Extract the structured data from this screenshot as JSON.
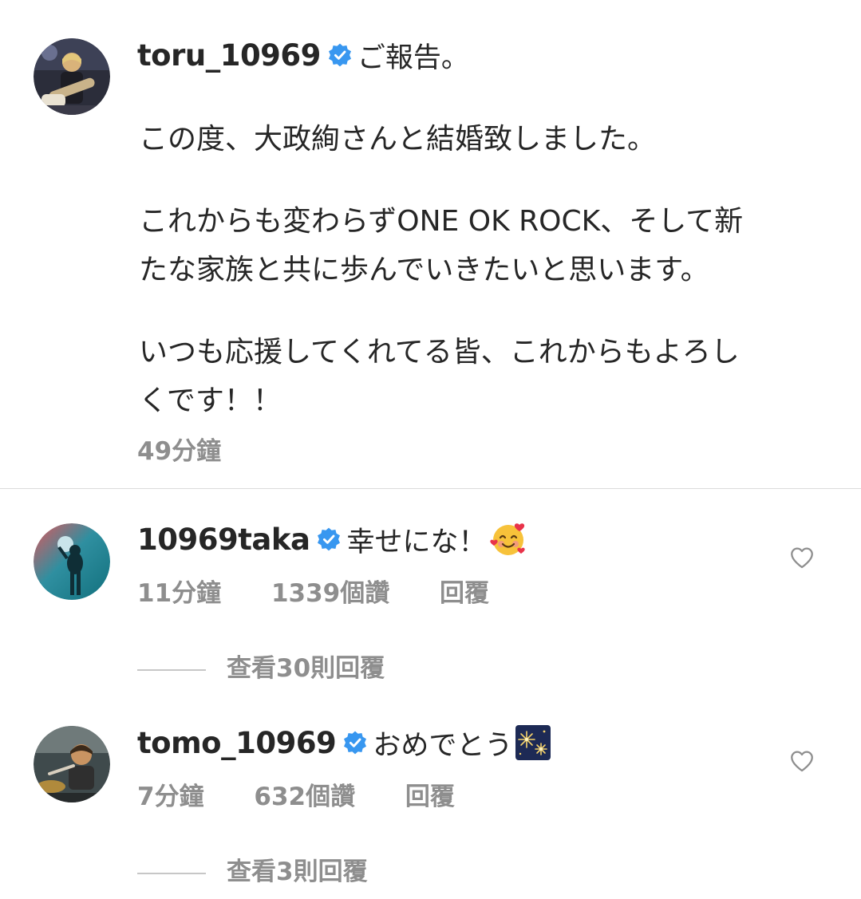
{
  "post": {
    "username": "toru_10969",
    "caption_title": "ご報告。",
    "caption_lines": [
      "この度、大政絢さんと結婚致しました。",
      "これからも変わらずONE OK ROCK、そして新",
      "たな家族と共に歩んでいきたいと思います。",
      "いつも応援してくれてる皆、これからもよろし",
      "くです！！"
    ],
    "time": "49分鐘",
    "avatar_icon": "guitarist-avatar"
  },
  "comments": [
    {
      "username": "10969taka",
      "text": "幸せにな！",
      "emoji": "smiling-face-with-hearts-emoji",
      "time": "11分鐘",
      "likes": "1339個讚",
      "reply": "回覆",
      "view_replies": "查看30則回覆"
    },
    {
      "username": "tomo_10969",
      "text": "おめでとう",
      "emoji": "fireworks-emoji",
      "time": "7分鐘",
      "likes": "632個讚",
      "reply": "回覆",
      "view_replies": "查看3則回覆"
    }
  ],
  "colors": {
    "text": "#262626",
    "secondary": "#8e8e8e",
    "verified": "#3897f0",
    "divider": "#dbdbdb"
  }
}
